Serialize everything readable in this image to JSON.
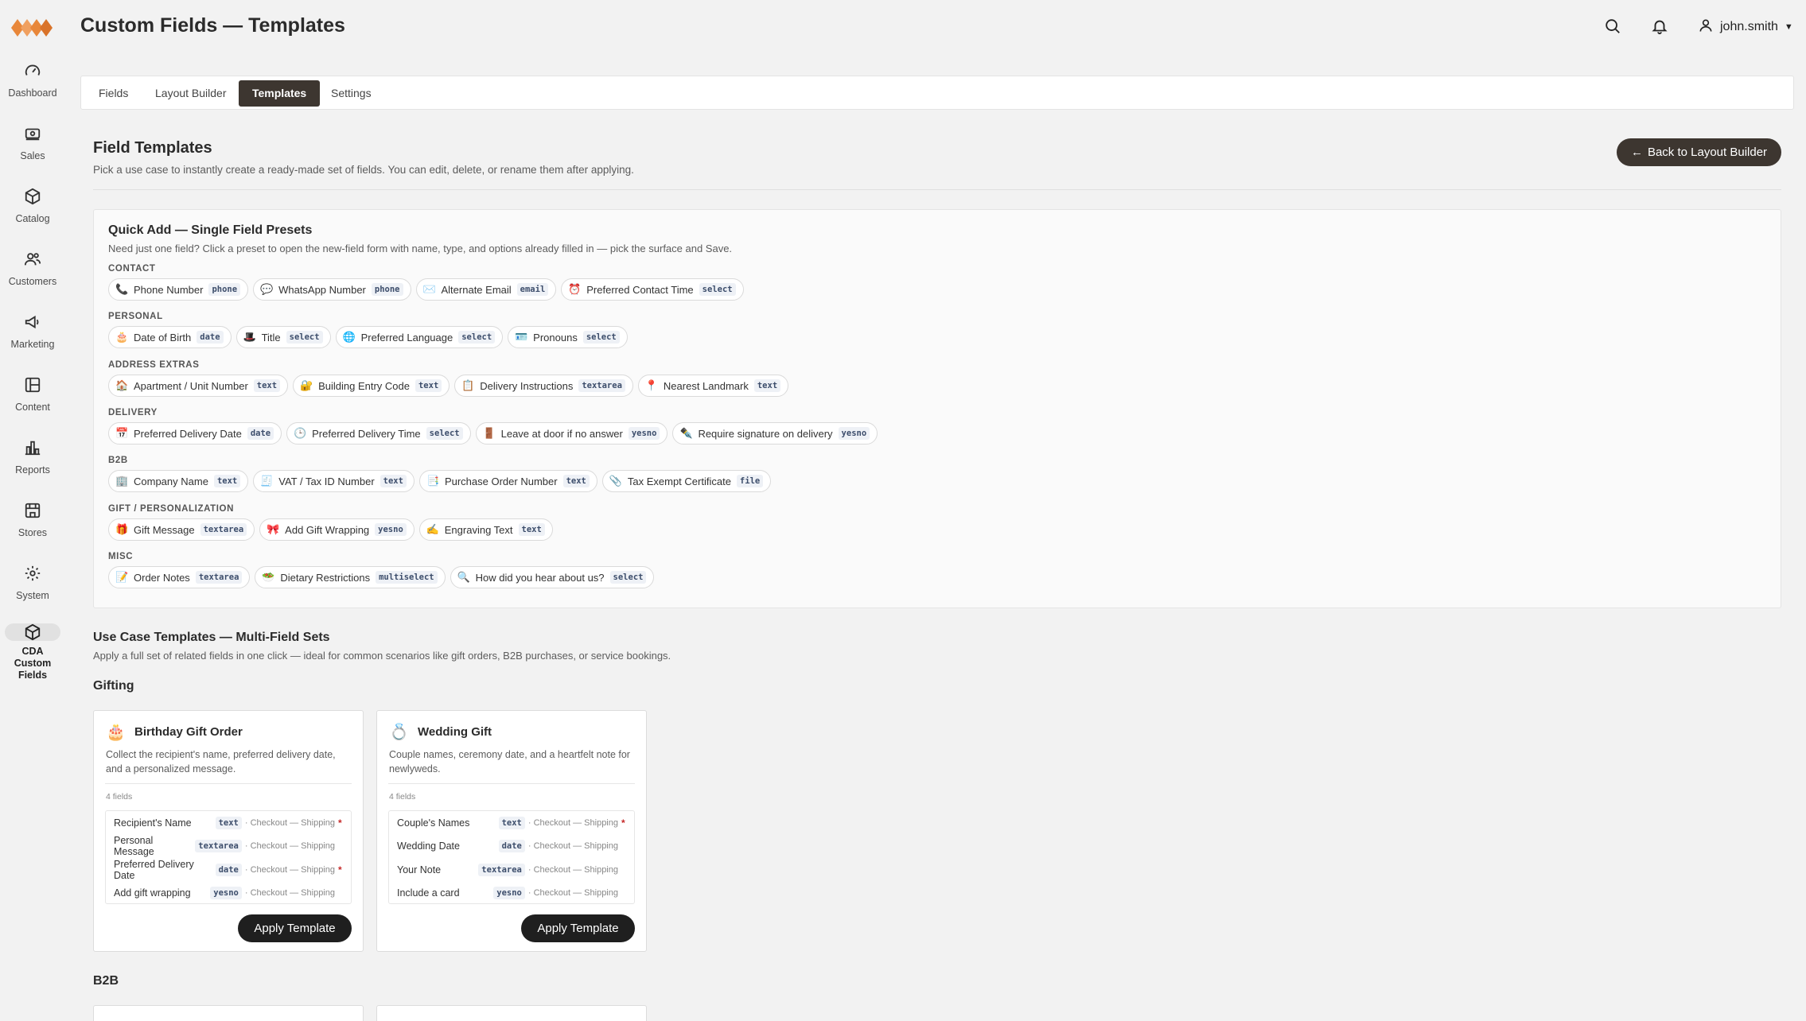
{
  "app": {
    "page_title": "Custom Fields — Templates",
    "user": "john.smith",
    "brand_color": "#e8873a"
  },
  "sidebar": {
    "items": [
      {
        "label": "Dashboard",
        "icon": "speedometer-icon"
      },
      {
        "label": "Sales",
        "icon": "cash-icon"
      },
      {
        "label": "Catalog",
        "icon": "cube-icon"
      },
      {
        "label": "Customers",
        "icon": "users-icon"
      },
      {
        "label": "Marketing",
        "icon": "megaphone-icon"
      },
      {
        "label": "Content",
        "icon": "layout-icon"
      },
      {
        "label": "Reports",
        "icon": "bar-chart-icon"
      },
      {
        "label": "Stores",
        "icon": "storefront-icon"
      },
      {
        "label": "System",
        "icon": "gear-icon"
      },
      {
        "label": "CDA Custom Fields",
        "icon": "box-icon",
        "active": true
      }
    ]
  },
  "tabs": [
    {
      "label": "Fields"
    },
    {
      "label": "Layout Builder"
    },
    {
      "label": "Templates",
      "active": true
    },
    {
      "label": "Settings"
    }
  ],
  "field_templates": {
    "title": "Field Templates",
    "subtitle": "Pick a use case to instantly create a ready-made set of fields. You can edit, delete, or rename them after applying.",
    "back_button": "Back to Layout Builder"
  },
  "quick_add": {
    "title": "Quick Add — Single Field Presets",
    "subtitle": "Need just one field? Click a preset to open the new-field form with name, type, and options already filled in — pick the surface and Save.",
    "groups": [
      {
        "label": "CONTACT",
        "chips": [
          {
            "emoji": "📞",
            "label": "Phone Number",
            "type": "phone"
          },
          {
            "emoji": "💬",
            "label": "WhatsApp Number",
            "type": "phone"
          },
          {
            "emoji": "✉️",
            "label": "Alternate Email",
            "type": "email"
          },
          {
            "emoji": "⏰",
            "label": "Preferred Contact Time",
            "type": "select"
          }
        ]
      },
      {
        "label": "PERSONAL",
        "chips": [
          {
            "emoji": "🎂",
            "label": "Date of Birth",
            "type": "date"
          },
          {
            "emoji": "🎩",
            "label": "Title",
            "type": "select"
          },
          {
            "emoji": "🌐",
            "label": "Preferred Language",
            "type": "select"
          },
          {
            "emoji": "🪪",
            "label": "Pronouns",
            "type": "select"
          }
        ]
      },
      {
        "label": "ADDRESS EXTRAS",
        "chips": [
          {
            "emoji": "🏠",
            "label": "Apartment / Unit Number",
            "type": "text"
          },
          {
            "emoji": "🔐",
            "label": "Building Entry Code",
            "type": "text"
          },
          {
            "emoji": "📋",
            "label": "Delivery Instructions",
            "type": "textarea"
          },
          {
            "emoji": "📍",
            "label": "Nearest Landmark",
            "type": "text"
          }
        ]
      },
      {
        "label": "DELIVERY",
        "chips": [
          {
            "emoji": "📅",
            "label": "Preferred Delivery Date",
            "type": "date"
          },
          {
            "emoji": "🕒",
            "label": "Preferred Delivery Time",
            "type": "select"
          },
          {
            "emoji": "🚪",
            "label": "Leave at door if no answer",
            "type": "yesno"
          },
          {
            "emoji": "✒️",
            "label": "Require signature on delivery",
            "type": "yesno"
          }
        ]
      },
      {
        "label": "B2B",
        "chips": [
          {
            "emoji": "🏢",
            "label": "Company Name",
            "type": "text"
          },
          {
            "emoji": "🧾",
            "label": "VAT / Tax ID Number",
            "type": "text"
          },
          {
            "emoji": "📑",
            "label": "Purchase Order Number",
            "type": "text"
          },
          {
            "emoji": "📎",
            "label": "Tax Exempt Certificate",
            "type": "file"
          }
        ]
      },
      {
        "label": "GIFT / PERSONALIZATION",
        "chips": [
          {
            "emoji": "🎁",
            "label": "Gift Message",
            "type": "textarea"
          },
          {
            "emoji": "🎀",
            "label": "Add Gift Wrapping",
            "type": "yesno"
          },
          {
            "emoji": "✍️",
            "label": "Engraving Text",
            "type": "text"
          }
        ]
      },
      {
        "label": "MISC",
        "chips": [
          {
            "emoji": "📝",
            "label": "Order Notes",
            "type": "textarea"
          },
          {
            "emoji": "🥗",
            "label": "Dietary Restrictions",
            "type": "multiselect"
          },
          {
            "emoji": "🔍",
            "label": "How did you hear about us?",
            "type": "select"
          }
        ]
      }
    ]
  },
  "use_cases": {
    "title": "Use Case Templates — Multi-Field Sets",
    "subtitle": "Apply a full set of related fields in one click — ideal for common scenarios like gift orders, B2B purchases, or service bookings.",
    "categories": [
      {
        "title": "Gifting",
        "cards": [
          {
            "emoji": "🎂",
            "name": "Birthday Gift Order",
            "description": "Collect the recipient's name, preferred delivery date, and a personalized message.",
            "count": "4 fields",
            "fields": [
              {
                "name": "Recipient's Name",
                "type": "text",
                "surface": "· Checkout — Shipping",
                "required": "*"
              },
              {
                "name": "Personal Message",
                "type": "textarea",
                "surface": "· Checkout — Shipping",
                "required": ""
              },
              {
                "name": "Preferred Delivery Date",
                "type": "date",
                "surface": "· Checkout — Shipping",
                "required": "*"
              },
              {
                "name": "Add gift wrapping",
                "type": "yesno",
                "surface": "· Checkout — Shipping",
                "required": ""
              }
            ],
            "button": "Apply Template"
          },
          {
            "emoji": "💍",
            "name": "Wedding Gift",
            "description": "Couple names, ceremony date, and a heartfelt note for newlyweds.",
            "count": "4 fields",
            "fields": [
              {
                "name": "Couple's Names",
                "type": "text",
                "surface": "· Checkout — Shipping",
                "required": "*"
              },
              {
                "name": "Wedding Date",
                "type": "date",
                "surface": "· Checkout — Shipping",
                "required": ""
              },
              {
                "name": "Your Note",
                "type": "textarea",
                "surface": "· Checkout — Shipping",
                "required": ""
              },
              {
                "name": "Include a card",
                "type": "yesno",
                "surface": "· Checkout — Shipping",
                "required": ""
              }
            ],
            "button": "Apply Template"
          }
        ]
      },
      {
        "title": "B2B"
      }
    ]
  }
}
